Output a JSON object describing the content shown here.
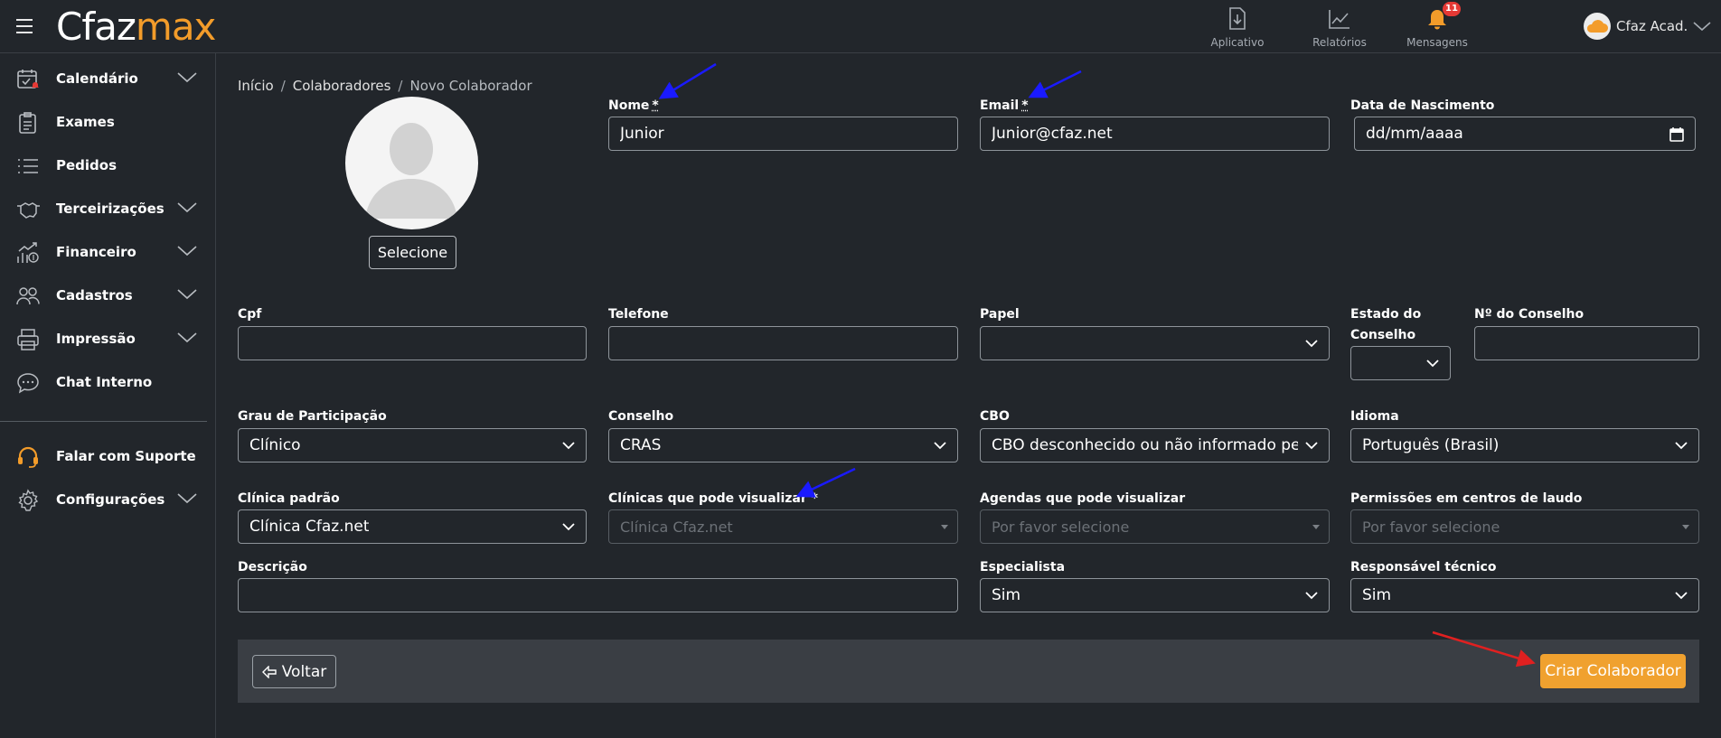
{
  "app": {
    "logo_part1": "Cfaz",
    "logo_part2": "max",
    "brand_color": "#f39c2a"
  },
  "topnav": {
    "items": [
      {
        "label": "Aplicativo",
        "icon": "download-app-icon"
      },
      {
        "label": "Relatórios",
        "icon": "chart-line-icon"
      },
      {
        "label": "Mensagens",
        "icon": "bell-icon",
        "badge": "11"
      }
    ],
    "user_name": "Cfaz Acad."
  },
  "sidebar": {
    "items": [
      {
        "label": "Calendário",
        "icon": "calendar-icon",
        "has_submenu": true
      },
      {
        "label": "Exames",
        "icon": "clipboard-icon",
        "has_submenu": false
      },
      {
        "label": "Pedidos",
        "icon": "list-icon",
        "has_submenu": false
      },
      {
        "label": "Terceirizações",
        "icon": "handshake-icon",
        "has_submenu": true
      },
      {
        "label": "Financeiro",
        "icon": "finance-chart-icon",
        "has_submenu": true
      },
      {
        "label": "Cadastros",
        "icon": "users-icon",
        "has_submenu": true
      },
      {
        "label": "Impressão",
        "icon": "printer-icon",
        "has_submenu": true
      },
      {
        "label": "Chat Interno",
        "icon": "chat-icon",
        "has_submenu": false
      },
      {
        "label": "Falar com Suporte",
        "icon": "headset-icon",
        "has_submenu": false
      },
      {
        "label": "Configurações",
        "icon": "gear-icon",
        "has_submenu": true
      }
    ]
  },
  "breadcrumb": {
    "home": "Início",
    "section": "Colaboradores",
    "current": "Novo Colaborador"
  },
  "photo": {
    "select_label": "Selecione"
  },
  "form": {
    "nome": {
      "label": "Nome",
      "required_mark": "*",
      "value": "Junior"
    },
    "email": {
      "label": "Email",
      "required_mark": "*",
      "value": "Junior@cfaz.net"
    },
    "data_nascimento": {
      "label": "Data de Nascimento",
      "placeholder": "dd/mm/aaaa"
    },
    "cpf": {
      "label": "Cpf",
      "value": ""
    },
    "telefone": {
      "label": "Telefone",
      "value": ""
    },
    "papel": {
      "label": "Papel",
      "value": ""
    },
    "estado_conselho": {
      "label_line1": "Estado do",
      "label_line2": "Conselho",
      "value": ""
    },
    "numero_conselho": {
      "label": "Nº do Conselho",
      "value": ""
    },
    "grau_participacao": {
      "label": "Grau de Participação",
      "value": "Clínico"
    },
    "conselho": {
      "label": "Conselho",
      "value": "CRAS"
    },
    "cbo": {
      "label": "CBO",
      "value": "CBO desconhecido ou não informado pelo solicitante"
    },
    "idioma": {
      "label": "Idioma",
      "value": "Português (Brasil)"
    },
    "clinica_padrao": {
      "label": "Clínica padrão",
      "value": "Clínica Cfaz.net"
    },
    "clinicas_visualizar": {
      "label": "Clínicas que pode visualizar *",
      "placeholder": "Clínica Cfaz.net"
    },
    "agendas_visualizar": {
      "label": "Agendas que pode visualizar",
      "placeholder": "Por favor selecione"
    },
    "permissoes_laudo": {
      "label": "Permissões em centros de laudo",
      "placeholder": "Por favor selecione"
    },
    "descricao": {
      "label": "Descrição",
      "value": ""
    },
    "especialista": {
      "label": "Especialista",
      "value": "Sim"
    },
    "responsavel_tecnico": {
      "label": "Responsável técnico",
      "value": "Sim"
    }
  },
  "actions": {
    "back_label": "Voltar",
    "create_label": "Criar Colaborador",
    "create_color": "#f0a12f"
  },
  "annotations": {
    "required_arrow_color": "#1a1aff",
    "submit_arrow_color": "#e02020"
  }
}
